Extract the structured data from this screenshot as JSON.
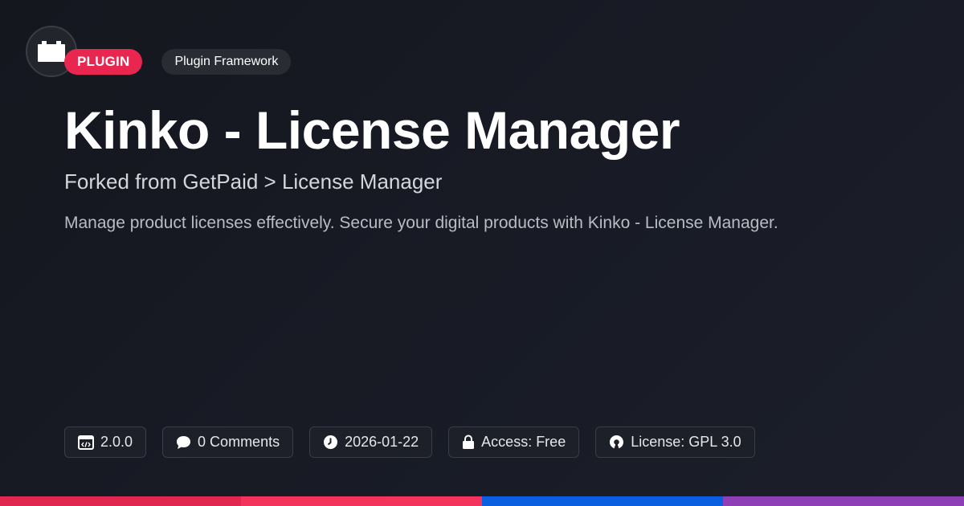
{
  "header": {
    "badge_label": "PLUGIN",
    "category_label": "Plugin Framework"
  },
  "main": {
    "title": "Kinko - License Manager",
    "subtitle": "Forked from GetPaid > License Manager",
    "description": "Manage product licenses effectively. Secure your digital products with Kinko - License Manager."
  },
  "meta": {
    "version": "2.0.0",
    "comments": "0 Comments",
    "date": "2026-01-22",
    "access": "Access: Free",
    "license": "License: GPL 3.0"
  },
  "icons": {
    "logo": "plugin-block-icon",
    "version": "code-window-icon",
    "comments": "speech-bubble-icon",
    "date": "clock-icon",
    "access": "lock-icon",
    "license": "open-source-icon"
  },
  "colors": {
    "badge": "#e8264f",
    "stripe": [
      "#e0274f",
      "#f3335c",
      "#0a5fe0",
      "#8e3fb5"
    ]
  }
}
